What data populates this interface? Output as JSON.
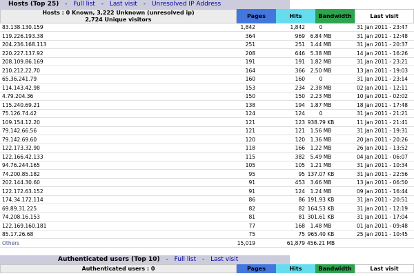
{
  "hosts": {
    "title": "Hosts (Top 25)",
    "sep": "-",
    "links": [
      "Full list",
      "Last visit",
      "Unresolved IP Address"
    ],
    "summary_line1": "Hosts : 0 Known, 3,222 Unknown (unresolved ip)",
    "summary_line2": "2,724 Unique visitors",
    "columns": {
      "pages": "Pages",
      "hits": "Hits",
      "bandwidth": "Bandwidth",
      "last_visit": "Last visit"
    },
    "rows": [
      {
        "host": "83.138.130.159",
        "pages": "1,842",
        "hits": "1,842",
        "bw": "0",
        "lv": "31 Jan 2011 - 23:47"
      },
      {
        "host": "119.226.193.38",
        "pages": "364",
        "hits": "969",
        "bw": "6.84 MB",
        "lv": "31 Jan 2011 - 12:48"
      },
      {
        "host": "204.236.168.113",
        "pages": "251",
        "hits": "251",
        "bw": "1.44 MB",
        "lv": "31 Jan 2011 - 20:37"
      },
      {
        "host": "220.227.137.92",
        "pages": "208",
        "hits": "646",
        "bw": "5.38 MB",
        "lv": "14 Jan 2011 - 16:26"
      },
      {
        "host": "208.109.86.169",
        "pages": "191",
        "hits": "191",
        "bw": "1.82 MB",
        "lv": "31 Jan 2011 - 23:21"
      },
      {
        "host": "210.212.22.70",
        "pages": "164",
        "hits": "366",
        "bw": "2.50 MB",
        "lv": "13 Jan 2011 - 19:03"
      },
      {
        "host": "65.36.241.79",
        "pages": "160",
        "hits": "160",
        "bw": "0",
        "lv": "31 Jan 2011 - 23:14"
      },
      {
        "host": "114.143.42.98",
        "pages": "153",
        "hits": "234",
        "bw": "2.38 MB",
        "lv": "02 Jan 2011 - 12:11"
      },
      {
        "host": "4.79.204.36",
        "pages": "150",
        "hits": "150",
        "bw": "2.23 MB",
        "lv": "10 Jan 2011 - 02:02"
      },
      {
        "host": "115.240.69.21",
        "pages": "138",
        "hits": "194",
        "bw": "1.87 MB",
        "lv": "18 Jan 2011 - 17:48"
      },
      {
        "host": "75.126.74.42",
        "pages": "124",
        "hits": "124",
        "bw": "0",
        "lv": "31 Jan 2011 - 21:21"
      },
      {
        "host": "109.154.12.20",
        "pages": "121",
        "hits": "123",
        "bw": "938.79 KB",
        "lv": "11 Jan 2011 - 21:41"
      },
      {
        "host": "79.142.66.56",
        "pages": "121",
        "hits": "121",
        "bw": "1.56 MB",
        "lv": "31 Jan 2011 - 19:31"
      },
      {
        "host": "79.142.69.60",
        "pages": "120",
        "hits": "120",
        "bw": "1.36 MB",
        "lv": "20 Jan 2011 - 20:26"
      },
      {
        "host": "122.173.32.90",
        "pages": "118",
        "hits": "166",
        "bw": "1.22 MB",
        "lv": "26 Jan 2011 - 13:52"
      },
      {
        "host": "122.166.42.133",
        "pages": "115",
        "hits": "382",
        "bw": "5.49 MB",
        "lv": "04 Jan 2011 - 06:07"
      },
      {
        "host": "94.76.244.165",
        "pages": "105",
        "hits": "105",
        "bw": "1.21 MB",
        "lv": "31 Jan 2011 - 10:34"
      },
      {
        "host": "74.200.85.182",
        "pages": "95",
        "hits": "95",
        "bw": "137.07 KB",
        "lv": "31 Jan 2011 - 22:56"
      },
      {
        "host": "202.144.30.60",
        "pages": "91",
        "hits": "453",
        "bw": "3.66 MB",
        "lv": "13 Jan 2011 - 06:50"
      },
      {
        "host": "122.172.63.152",
        "pages": "91",
        "hits": "124",
        "bw": "1.24 MB",
        "lv": "09 Jan 2011 - 16:44"
      },
      {
        "host": "174.34.172.114",
        "pages": "86",
        "hits": "86",
        "bw": "191.93 KB",
        "lv": "31 Jan 2011 - 20:51"
      },
      {
        "host": "69.89.31.225",
        "pages": "82",
        "hits": "82",
        "bw": "164.53 KB",
        "lv": "31 Jan 2011 - 12:19"
      },
      {
        "host": "74.208.16.153",
        "pages": "81",
        "hits": "81",
        "bw": "301.61 KB",
        "lv": "31 Jan 2011 - 17:04"
      },
      {
        "host": "122.169.160.181",
        "pages": "77",
        "hits": "168",
        "bw": "1.48 MB",
        "lv": "01 Jan 2011 - 09:48"
      },
      {
        "host": "85.17.26.68",
        "pages": "75",
        "hits": "75",
        "bw": "965.40 KB",
        "lv": "25 Jan 2011 - 10:45"
      }
    ],
    "others": {
      "host": "Others",
      "pages": "15,019",
      "hits": "61,879",
      "bw": "456.21 MB"
    }
  },
  "auth": {
    "title": "Authenticated users (Top 10)",
    "sep": "-",
    "links": [
      "Full list",
      "Last visit"
    ],
    "summary": "Authenticated users : 0",
    "columns": {
      "pages": "Pages",
      "hits": "Hits",
      "bandwidth": "Bandwidth",
      "last_visit": "Last visit"
    }
  }
}
